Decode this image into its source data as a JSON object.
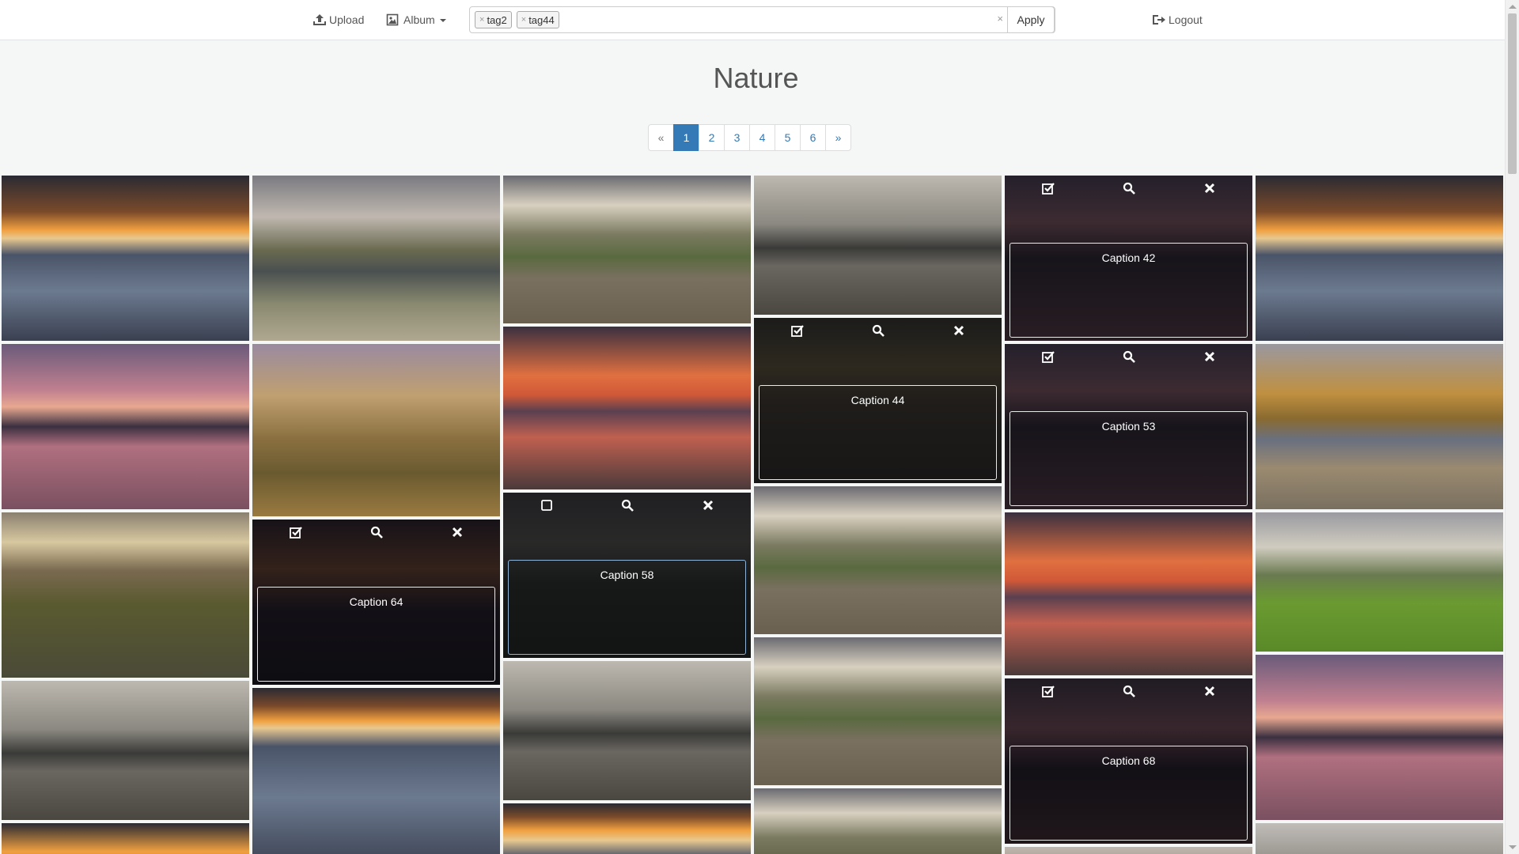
{
  "nav": {
    "upload_label": "Upload",
    "album_label": "Album",
    "logout_label": "Logout",
    "tags": [
      "tag2",
      "tag44"
    ],
    "tag_remove": "×",
    "clear_symbol": "×",
    "apply_label": "Apply"
  },
  "title": "Nature",
  "pagination": {
    "prev": "«",
    "pages": [
      "1",
      "2",
      "3",
      "4",
      "5",
      "6"
    ],
    "active": "1",
    "next": "»"
  },
  "captions": {
    "c42": "Caption 42",
    "c44": "Caption 44",
    "c53": "Caption 53",
    "c58": "Caption 58",
    "c64": "Caption 64",
    "c68": "Caption 68"
  },
  "colors": {
    "accent": "#337ab7",
    "overlay": "#0a0a0c"
  },
  "icons": [
    "upload-icon",
    "album-image-icon",
    "logout-icon",
    "checkbox-checked-icon",
    "checkbox-empty-icon",
    "zoom-icon",
    "remove-icon"
  ]
}
